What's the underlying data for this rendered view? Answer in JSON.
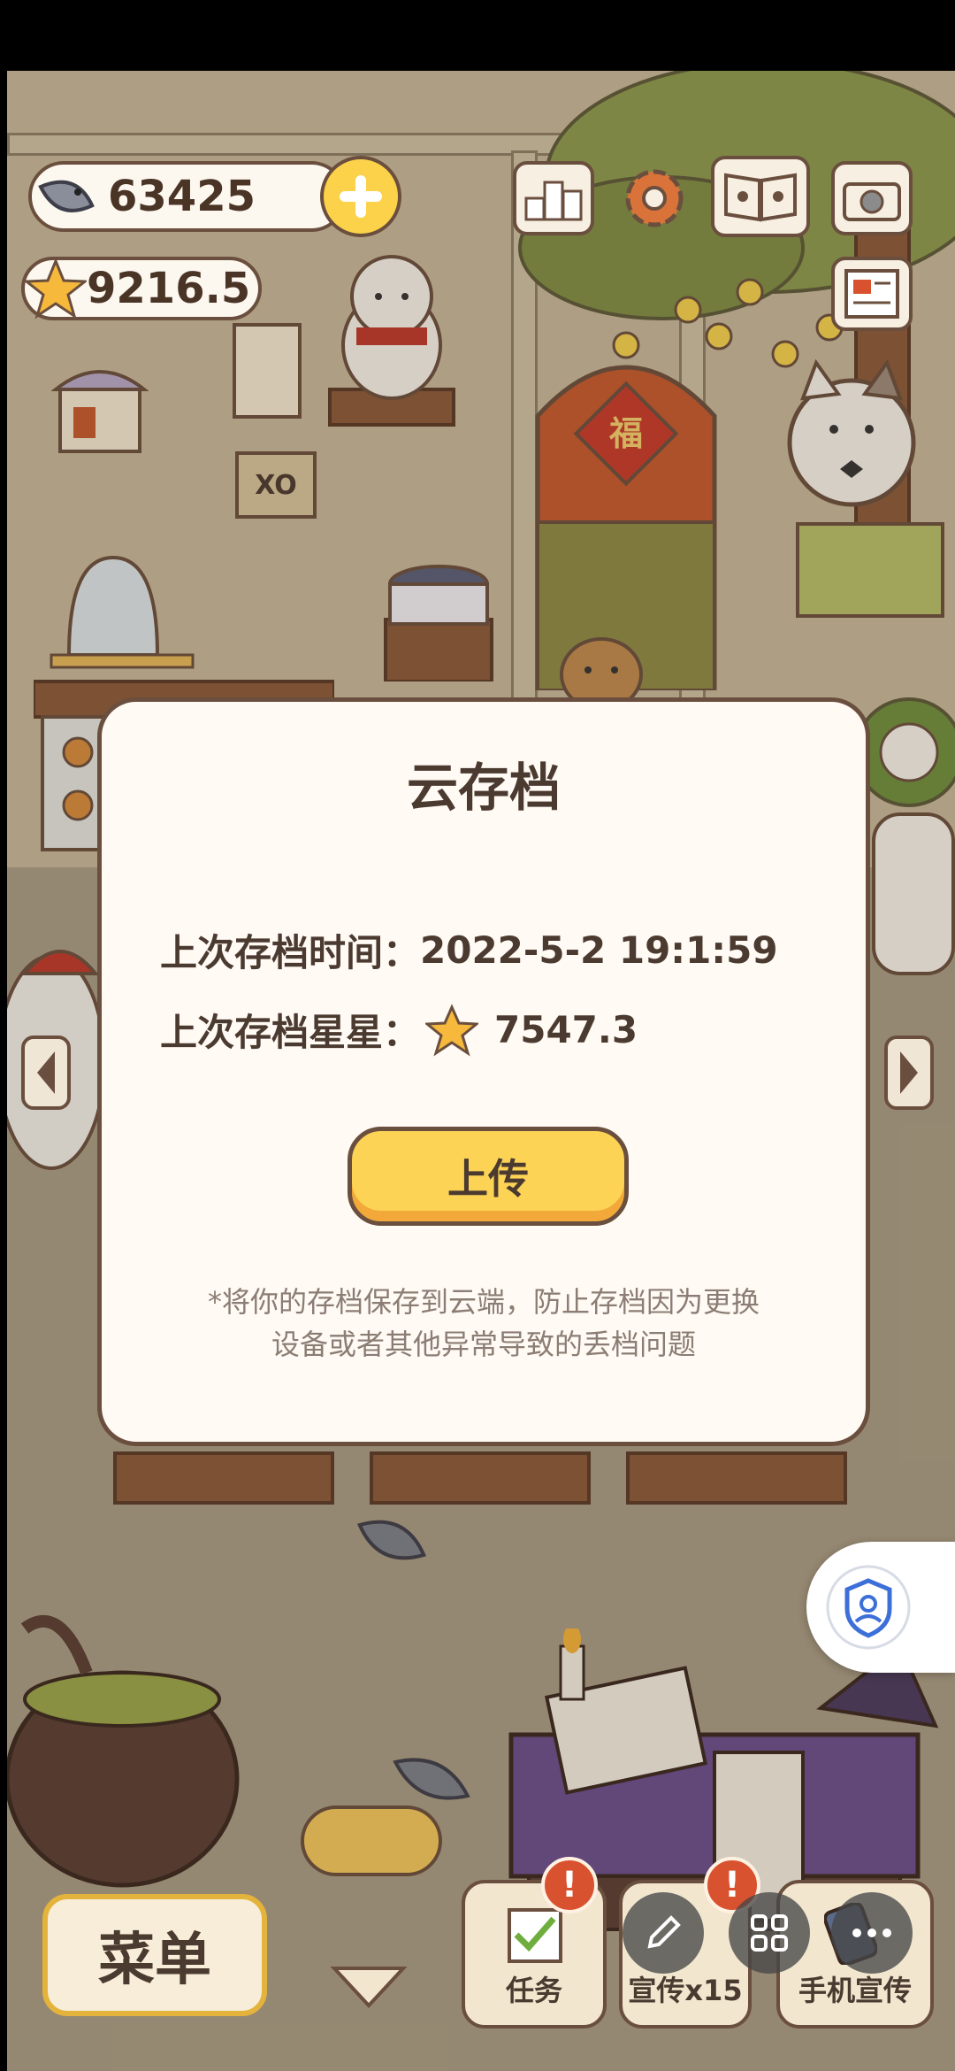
{
  "resources": {
    "fish": "63425",
    "stars": "9216.5"
  },
  "top_icons": [
    "leaderboard-icon",
    "gear-icon",
    "book-icon",
    "camera-icon",
    "newspaper-icon"
  ],
  "dialog": {
    "title": "云存档",
    "last_save_time_label": "上次存档时间：",
    "last_save_time_value": "2022-5-2 19:1:59",
    "last_save_stars_label": "上次存档星星：",
    "last_save_stars_value": "7547.3",
    "upload_label": "上传",
    "note_line1": "*将你的存档保存到云端，防止存档因为更换",
    "note_line2": "设备或者其他异常导致的丢档问题"
  },
  "scene_signs": {
    "board_text": "XO",
    "door_sign": "福"
  },
  "bottom_bar": {
    "menu_label": "菜单",
    "tasks_label": "任务",
    "promote_label": "宣传x15",
    "phone_promote_label": "手机宣传"
  },
  "colors": {
    "accent_yellow": "#fcd355",
    "brown_outline": "#6b4f3e",
    "alert_red": "#d9522f",
    "dialog_bg": "#fffaf4"
  }
}
